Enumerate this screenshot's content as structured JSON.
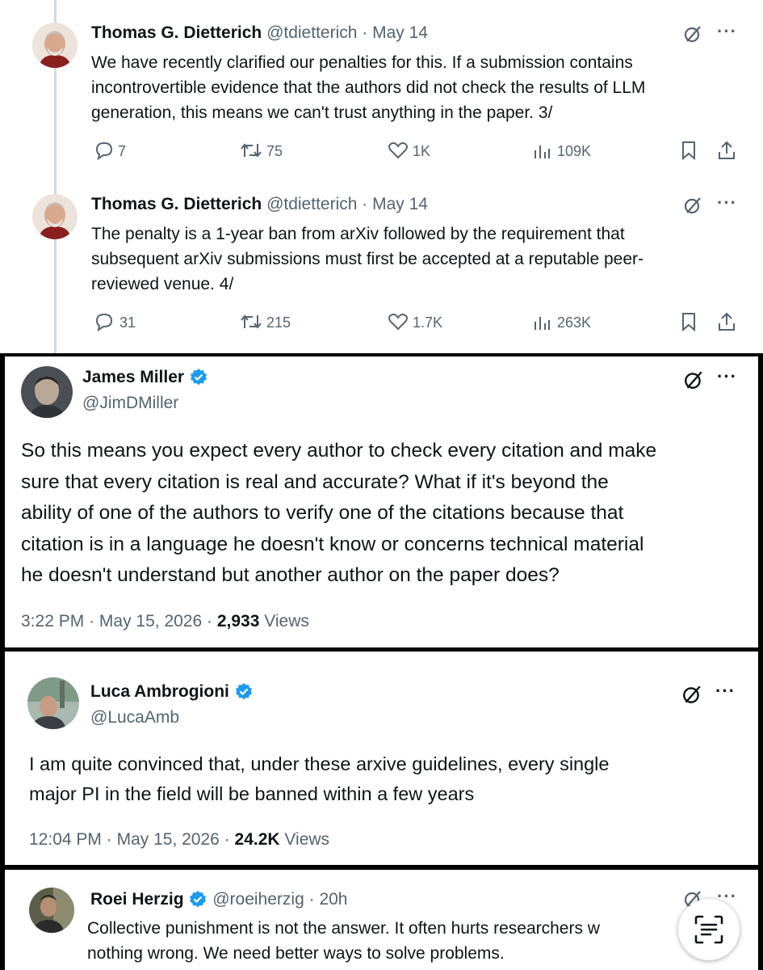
{
  "tweets": [
    {
      "author": "Thomas G. Dietterich",
      "handle": "@tdietterich",
      "date": "May 14",
      "text_lines": [
        "We have recently clarified our penalties for this. If a submission contains",
        "incontrovertible evidence that the authors did not check the results of LLM",
        "generation, this means we can't trust anything in the paper. 3/"
      ],
      "replies": "7",
      "reposts": "75",
      "likes": "1K",
      "views": "109K"
    },
    {
      "author": "Thomas G. Dietterich",
      "handle": "@tdietterich",
      "date": "May 14",
      "text_lines": [
        "The penalty is a 1-year ban from arXiv followed by the requirement that",
        "subsequent arXiv submissions must first be accepted at a reputable peer-",
        "reviewed venue. 4/"
      ],
      "replies": "31",
      "reposts": "215",
      "likes": "1.7K",
      "views": "263K"
    },
    {
      "author": "James Miller",
      "handle": "@JimDMiller",
      "text_lines": [
        "So this means you expect every author to check every citation and make",
        "sure that every citation is real and accurate? What if it's beyond the",
        "ability of one of the authors to verify one of the citations because that",
        "citation is in a language he doesn't know or concerns technical material",
        "he doesn't understand but another author on the paper does?"
      ],
      "time": "3:22 PM",
      "date": "May 15, 2026",
      "views_count": "2,933",
      "views_label": "Views"
    },
    {
      "author": "Luca Ambrogioni",
      "handle": "@LucaAmb",
      "text_lines": [
        "I am quite convinced that, under these arxive guidelines, every single",
        "major PI in the field will be banned within a few years"
      ],
      "time": "12:04 PM",
      "date": "May 15, 2026",
      "views_count": "24.2K",
      "views_label": "Views"
    },
    {
      "author": "Roei Herzig",
      "handle": "@roeiherzig",
      "date": "20h",
      "text_lines": [
        "Collective punishment is not the answer. It often hurts researchers w",
        "nothing wrong. We need better ways to solve problems."
      ]
    }
  ],
  "separator": "·",
  "more_glyph": "···",
  "colors": {
    "verified": "#1d9bf0",
    "muted": "#536471",
    "text": "#0f1419",
    "thread_line": "#cfd9de"
  },
  "icons": [
    "grok-icon",
    "more-icon",
    "reply-icon",
    "repost-icon",
    "like-icon",
    "views-icon",
    "bookmark-icon",
    "share-icon",
    "verified-badge-icon",
    "text-scan-icon"
  ]
}
